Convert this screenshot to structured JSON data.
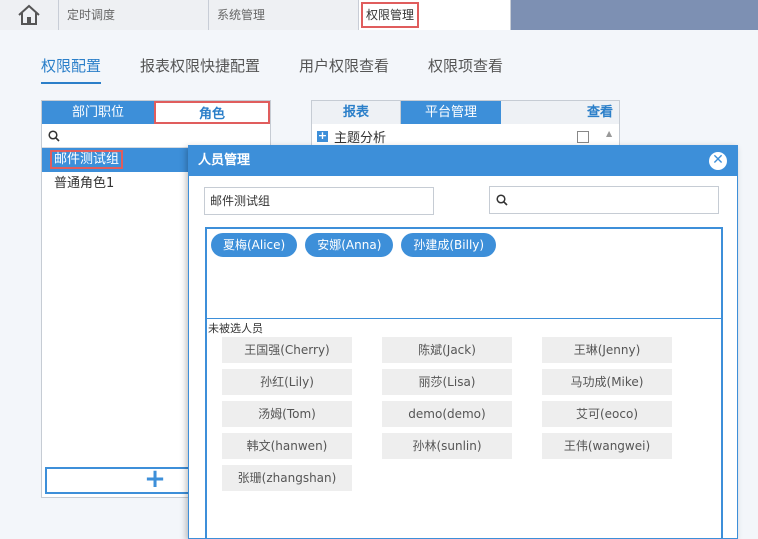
{
  "top_tabs": [
    {
      "label": "定时调度"
    },
    {
      "label": "系统管理"
    },
    {
      "label": "权限管理"
    }
  ],
  "sub_tabs": [
    {
      "label": "权限配置",
      "active": true
    },
    {
      "label": "报表权限快捷配置"
    },
    {
      "label": "用户权限查看"
    },
    {
      "label": "权限项查看"
    }
  ],
  "left_panel": {
    "tabs": [
      "部门职位",
      "角色"
    ],
    "roles": [
      "邮件测试组",
      "普通角色1"
    ],
    "add_label": "+"
  },
  "right_panel": {
    "tabs": [
      "报表",
      "平台管理",
      "查看"
    ],
    "rows": [
      "主题分析"
    ]
  },
  "modal": {
    "title": "人员管理",
    "name_value": "邮件测试组",
    "selected": [
      "夏梅(Alice)",
      "安娜(Anna)",
      "孙建成(Billy)"
    ],
    "unselected_label": "未被选人员",
    "unselected": [
      "王国强(Cherry)",
      "陈斌(Jack)",
      "王琳(Jenny)",
      "孙红(Lily)",
      "丽莎(Lisa)",
      "马功成(Mike)",
      "汤姆(Tom)",
      "demo(demo)",
      "艾可(eoco)",
      "韩文(hanwen)",
      "孙林(sunlin)",
      "王伟(wangwei)",
      "张珊(zhangshan)"
    ]
  },
  "colors": {
    "accent": "#3d8fd9",
    "highlight": "#e05d5d",
    "topbar": "#7d90b3"
  }
}
